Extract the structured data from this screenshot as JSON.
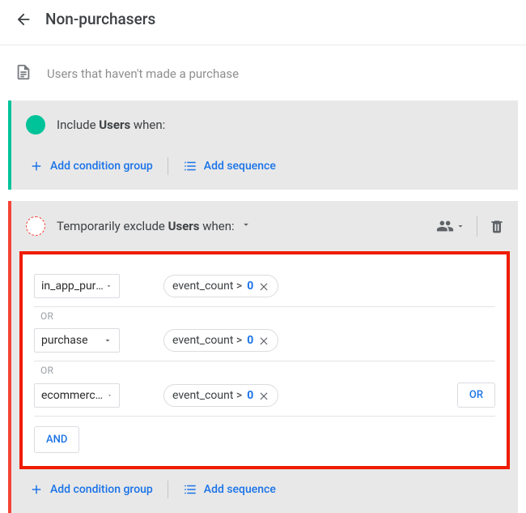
{
  "header": {
    "title": "Non-purchasers"
  },
  "description": {
    "placeholder": "Users that haven't made a purchase"
  },
  "include": {
    "prefix": "Include ",
    "subject": "Users",
    "suffix": " when:",
    "add_group": "Add condition group",
    "add_sequence": "Add sequence"
  },
  "exclude": {
    "prefix": "Temporarily exclude ",
    "subject": "Users",
    "suffix": " when:",
    "add_group": "Add condition group",
    "add_sequence": "Add sequence"
  },
  "conditions": {
    "fields": [
      "in_app_purchase",
      "purchase",
      "ecommerce_purchase"
    ],
    "metric_label": "event_count > ",
    "metric_value": "0",
    "or_sep": "OR",
    "or_btn": "OR",
    "and_btn": "AND"
  }
}
